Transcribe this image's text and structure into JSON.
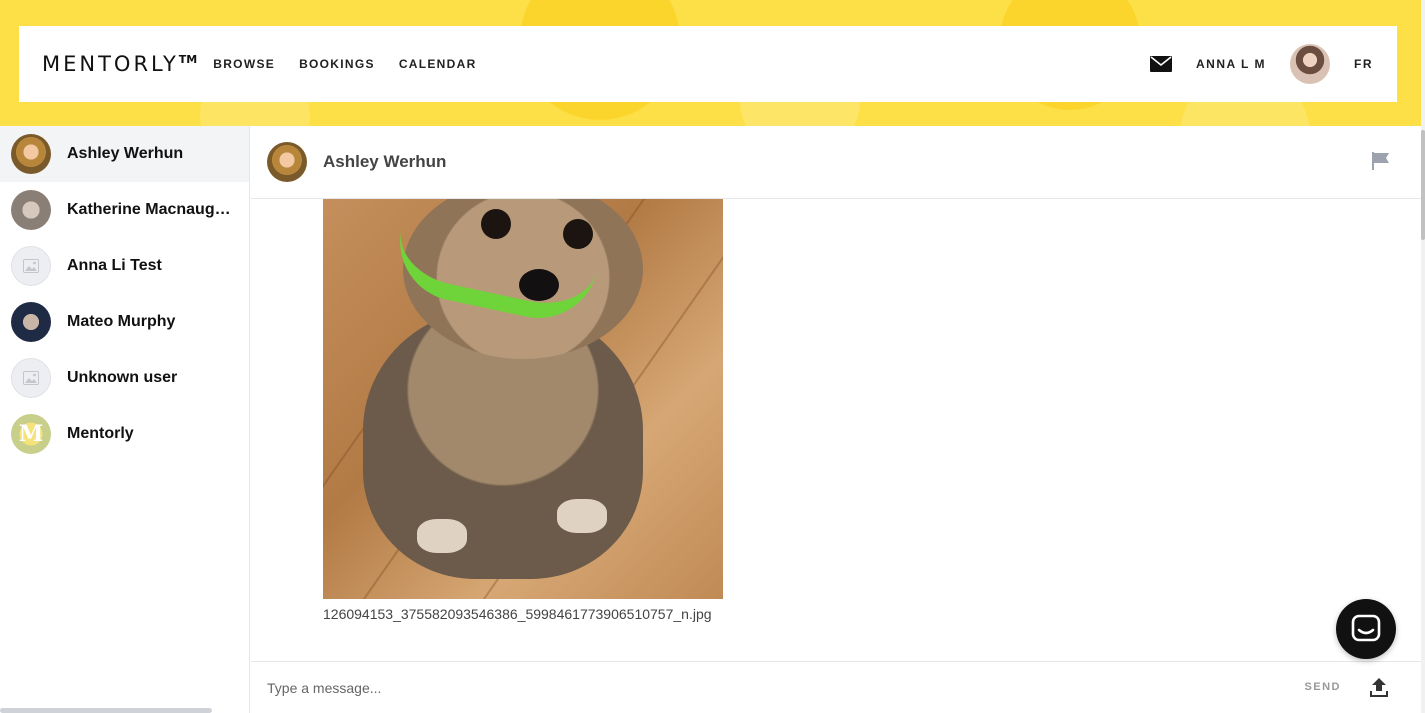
{
  "header": {
    "logo_text": "MENTORLY",
    "logo_mark": "TM",
    "nav": [
      {
        "label": "BROWSE"
      },
      {
        "label": "BOOKINGS"
      },
      {
        "label": "CALENDAR"
      }
    ],
    "user_name": "ANNA L M",
    "language": "FR",
    "icons": {
      "mail": "mail-icon",
      "avatar": "user-avatar"
    }
  },
  "sidebar": {
    "conversations": [
      {
        "name": "Ashley Werhun",
        "active": true
      },
      {
        "name": "Katherine Macnaughton",
        "active": false
      },
      {
        "name": "Anna Li Test",
        "active": false
      },
      {
        "name": "Mateo Murphy",
        "active": false
      },
      {
        "name": "Unknown user",
        "active": false
      },
      {
        "name": "Mentorly",
        "active": false
      }
    ]
  },
  "chat": {
    "title": "Ashley Werhun",
    "attachment_filename": "126094153_375582093546386_5998461773906510757_n.jpg",
    "composer_placeholder": "Type a message...",
    "send_label": "SEND",
    "icons": {
      "flag": "flag-icon",
      "upload": "upload-icon",
      "widget": "chat-bubble-icon"
    }
  },
  "colors": {
    "banner": "#fde047",
    "active_row": "#f3f4f6",
    "collar": "#6fd43a",
    "widget": "#111111"
  }
}
